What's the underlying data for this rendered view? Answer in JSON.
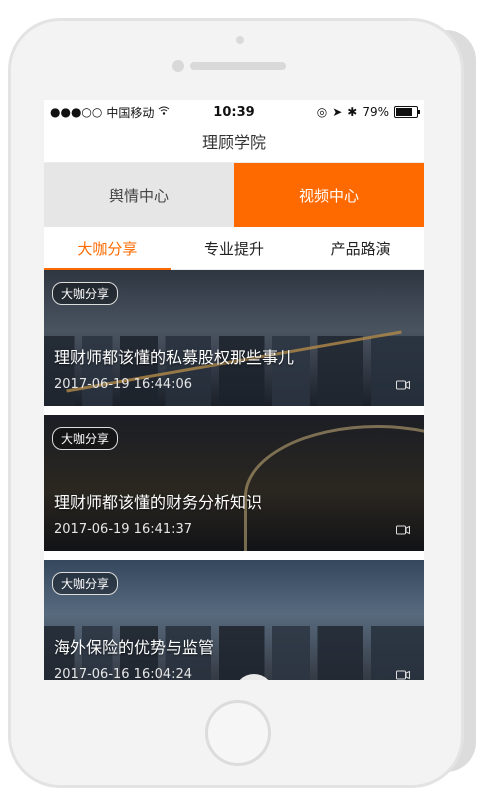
{
  "status": {
    "carrier": "中国移动",
    "time": "10:39",
    "battery": "79%",
    "battery_level": 0.79
  },
  "header": {
    "title": "理顾学院"
  },
  "segments": [
    {
      "label": "舆情中心",
      "active": false
    },
    {
      "label": "视频中心",
      "active": true
    }
  ],
  "subtabs": [
    {
      "label": "大咖分享",
      "active": true
    },
    {
      "label": "专业提升",
      "active": false
    },
    {
      "label": "产品路演",
      "active": false
    }
  ],
  "videos": [
    {
      "badge": "大咖分享",
      "title": "理财师都该懂的私募股权那些事儿",
      "time": "2017-06-19 16:44:06"
    },
    {
      "badge": "大咖分享",
      "title": "理财师都该懂的财务分析知识",
      "time": "2017-06-19 16:41:37"
    },
    {
      "badge": "大咖分享",
      "title": "海外保险的优势与监管",
      "time": "2017-06-16 16:04:24"
    }
  ],
  "colors": {
    "accent": "#ff6a00",
    "segment_inactive": "#e6e6e6"
  },
  "icons": {
    "wifi": "wifi-icon",
    "bluetooth": "bluetooth-icon",
    "location": "location-arrow-icon",
    "lock": "rotation-lock-icon",
    "video": "video-icon"
  }
}
